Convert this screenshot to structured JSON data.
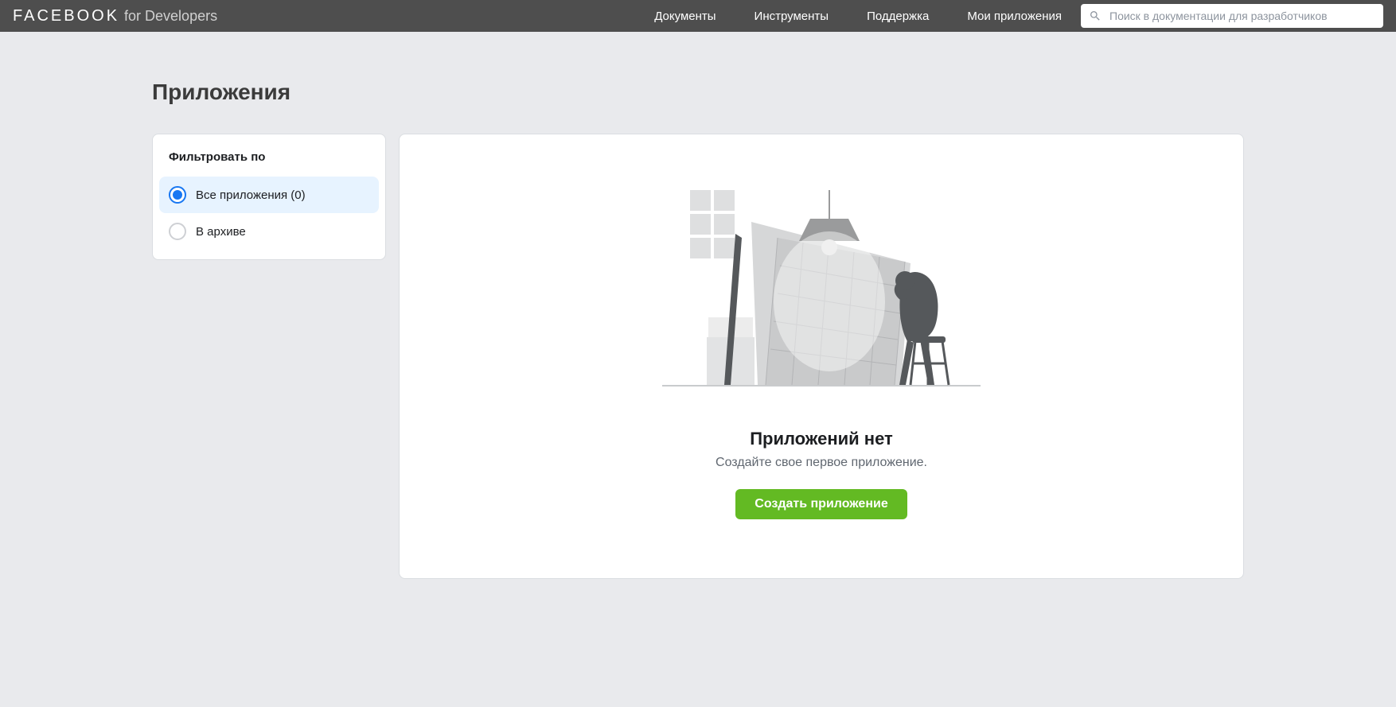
{
  "header": {
    "logo_main": "FACEBOOK",
    "logo_sub": "for Developers",
    "nav": {
      "docs": "Документы",
      "tools": "Инструменты",
      "support": "Поддержка",
      "my_apps": "Мои приложения"
    },
    "search_placeholder": "Поиск в документации для разработчиков"
  },
  "page": {
    "title": "Приложения"
  },
  "sidebar": {
    "filter_title": "Фильтровать по",
    "filters": {
      "all_apps": "Все приложения (0)",
      "archived": "В архиве"
    }
  },
  "main": {
    "empty_title": "Приложений нет",
    "empty_subtitle": "Создайте свое первое приложение.",
    "create_button": "Создать приложение"
  }
}
